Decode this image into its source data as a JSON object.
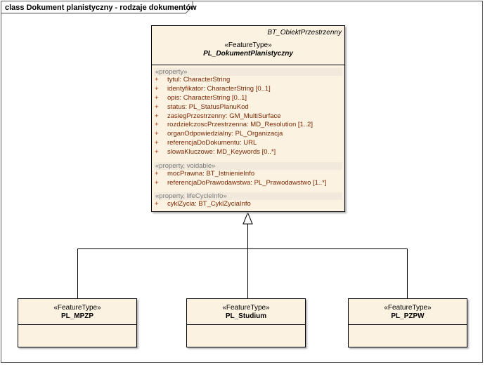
{
  "frame": {
    "title": "class Dokument planistyczny - rodzaje dokumentów"
  },
  "main_class": {
    "superclass": "BT_ObiektPrzestrzenny",
    "stereotype": "«FeatureType»",
    "name": "PL_DokumentPlanistyczny",
    "sections": [
      {
        "label": "«property»",
        "attributes": [
          {
            "visibility": "+",
            "name": "tytul:",
            "type": "CharacterString"
          },
          {
            "visibility": "+",
            "name": "identyfikator:",
            "type": "CharacterString [0..1]"
          },
          {
            "visibility": "+",
            "name": "opis:",
            "type": "CharacterString [0..1]"
          },
          {
            "visibility": "+",
            "name": "status:",
            "type": "PL_StatusPlanuKod"
          },
          {
            "visibility": "+",
            "name": "zasiegPrzestrzenny:",
            "type": "GM_MultiSurface"
          },
          {
            "visibility": "+",
            "name": "rozdzielczoscPrzestrzenna:",
            "type": "MD_Resolution [1..2]"
          },
          {
            "visibility": "+",
            "name": "organOdpowiedzialny:",
            "type": "PL_Organizacja"
          },
          {
            "visibility": "+",
            "name": "referencjaDoDokumentu:",
            "type": "URL"
          },
          {
            "visibility": "+",
            "name": "slowaKluczowe:",
            "type": "MD_Keywords [0..*]"
          }
        ]
      },
      {
        "label": "«property, voidable»",
        "attributes": [
          {
            "visibility": "+",
            "name": "mocPrawna:",
            "type": "BT_IstnienieInfo"
          },
          {
            "visibility": "+",
            "name": "referencjaDoPrawodawstwa:",
            "type": "PL_Prawodawstwo [1..*]"
          }
        ]
      },
      {
        "label": "«property, lifeCycleInfo»",
        "attributes": [
          {
            "visibility": "+",
            "name": "cyklZycia:",
            "type": "BT_CyklZyciaInfo"
          }
        ]
      }
    ]
  },
  "subclasses": [
    {
      "stereotype": "«FeatureType»",
      "name": "PL_MPZP"
    },
    {
      "stereotype": "«FeatureType»",
      "name": "PL_Studium"
    },
    {
      "stereotype": "«FeatureType»",
      "name": "PL_PZPW"
    }
  ],
  "colors": {
    "class_fill": "#fcf2e2",
    "section_label_fill": "#f1eadc",
    "attribute_text": "#7a2700",
    "line": "#000000"
  }
}
